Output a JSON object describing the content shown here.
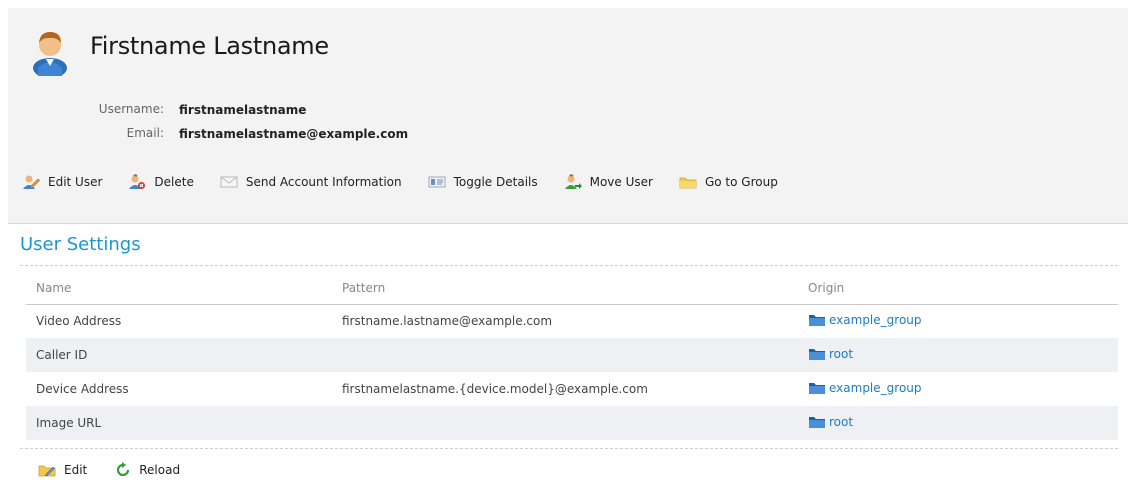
{
  "user": {
    "full_name": "Firstname Lastname",
    "username_label": "Username:",
    "username": "firstnamelastname",
    "email_label": "Email:",
    "email": "firstnamelastname@example.com"
  },
  "actions": [
    {
      "label": "Edit User",
      "icon": "edit-user-icon"
    },
    {
      "label": "Delete",
      "icon": "delete-user-icon"
    },
    {
      "label": "Send Account Information",
      "icon": "envelope-icon"
    },
    {
      "label": "Toggle Details",
      "icon": "details-card-icon"
    },
    {
      "label": "Move User",
      "icon": "move-user-icon"
    },
    {
      "label": "Go to Group",
      "icon": "folder-icon"
    }
  ],
  "settings": {
    "title": "User Settings",
    "columns": {
      "name": "Name",
      "pattern": "Pattern",
      "origin": "Origin"
    },
    "rows": [
      {
        "name": "Video Address",
        "pattern": "firstname.lastname@example.com",
        "origin": "example_group"
      },
      {
        "name": "Caller ID",
        "pattern": "",
        "origin": "root"
      },
      {
        "name": "Device Address",
        "pattern": "firstnamelastname.{device.model}@example.com",
        "origin": "example_group"
      },
      {
        "name": "Image URL",
        "pattern": "",
        "origin": "root"
      }
    ]
  },
  "footer_actions": {
    "edit": "Edit",
    "reload": "Reload"
  },
  "colors": {
    "accent": "#1a97d0",
    "link": "#1a7dc4",
    "header_bg": "#f3f3f3",
    "alt_row": "#eef0f3"
  }
}
